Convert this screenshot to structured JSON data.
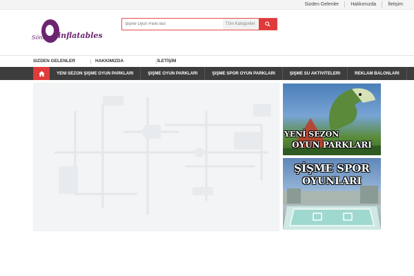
{
  "topbar": {
    "links": [
      "Sizden Gelenler",
      "Hakkımızda",
      "İletişim"
    ]
  },
  "logo": {
    "part1": "Sönmez",
    "part2": "inflatables"
  },
  "search": {
    "placeholder": "Şişme Oyun Parkı Bul",
    "category": "Tüm Kategoriler"
  },
  "subnav": {
    "items": [
      "SIZDEN GELENLER",
      "HAKKIMIZDA",
      "İLETİŞİM"
    ]
  },
  "mainnav": {
    "items": [
      "YENI SEZON ŞIŞME OYUN PARKLARI",
      "ŞIŞME OYUN PARKLARI",
      "ŞIŞME SPOR OYUN PARKLARI",
      "ŞIŞME SU AKTIVITELERI",
      "REKLAM BALONLARI"
    ]
  },
  "promos": [
    {
      "line1": "YENİ SEZON",
      "line2": "OYUN PARKLARI"
    },
    {
      "line1": "ŞİŞME SPOR",
      "line2": "OYUNLARI"
    }
  ],
  "colors": {
    "accent": "#e03a3a",
    "nav": "#3d3d3d",
    "brand": "#6b2470"
  }
}
